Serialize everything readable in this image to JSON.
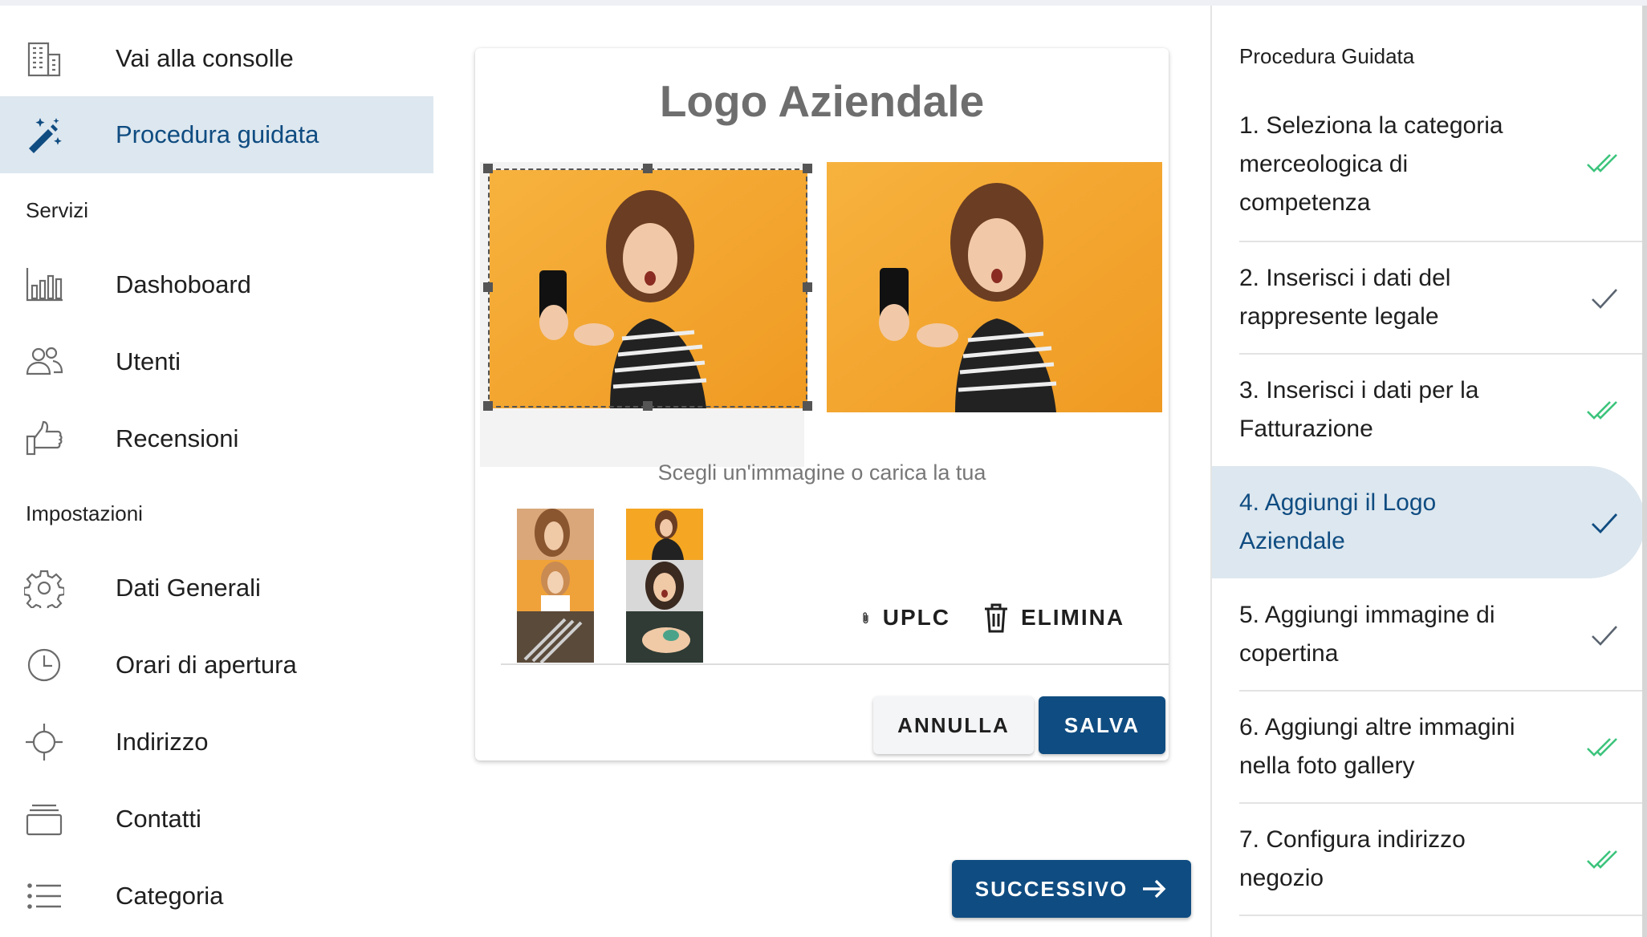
{
  "sidebar": {
    "top_items": [
      {
        "label": "Vai alla consolle",
        "icon": "building-icon"
      },
      {
        "label": "Procedura guidata",
        "icon": "magic-wand-icon",
        "active": true
      }
    ],
    "sections": [
      {
        "header": "Servizi",
        "items": [
          {
            "label": "Dashoboard",
            "icon": "bar-chart-icon"
          },
          {
            "label": "Utenti",
            "icon": "users-icon"
          },
          {
            "label": "Recensioni",
            "icon": "thumbs-up-icon"
          }
        ]
      },
      {
        "header": "Impostazioni",
        "items": [
          {
            "label": "Dati Generali",
            "icon": "gear-icon"
          },
          {
            "label": "Orari di apertura",
            "icon": "clock-icon"
          },
          {
            "label": "Indirizzo",
            "icon": "crosshair-icon"
          },
          {
            "label": "Contatti",
            "icon": "stack-icon"
          },
          {
            "label": "Categoria",
            "icon": "list-icon"
          }
        ]
      }
    ]
  },
  "card": {
    "title": "Logo Aziendale",
    "choose_text": "Scegli un'immagine o carica la tua",
    "upload_label": "UPLC",
    "delete_label": "ELIMINA",
    "cancel_label": "ANNULLA",
    "save_label": "SALVA"
  },
  "next_label": "SUCCESSIVO",
  "wizard": {
    "title": "Procedura Guidata",
    "steps": [
      {
        "lines": [
          "1. Seleziona la categoria",
          "merceologica di",
          "competenza"
        ],
        "status": "double-check"
      },
      {
        "lines": [
          "2. Inserisci i dati del",
          "rappresente legale"
        ],
        "status": "check"
      },
      {
        "lines": [
          "3. Inserisci i dati per la",
          "Fatturazione"
        ],
        "status": "double-check"
      },
      {
        "lines": [
          "4. Aggiungi il Logo",
          "Aziendale"
        ],
        "status": "check",
        "active": true
      },
      {
        "lines": [
          "5. Aggiungi immagine di",
          "copertina"
        ],
        "status": "check"
      },
      {
        "lines": [
          "6. Aggiungi altre immagini",
          "nella foto gallery"
        ],
        "status": "double-check"
      },
      {
        "lines": [
          "7. Configura indirizzo",
          "negozio"
        ],
        "status": "double-check"
      }
    ]
  },
  "colors": {
    "primary": "#0f4c81",
    "active_bg": "#dde7ef",
    "check_green": "#3cc47c",
    "check_grey": "#5a6470",
    "photo_orange": "#f5a623"
  }
}
